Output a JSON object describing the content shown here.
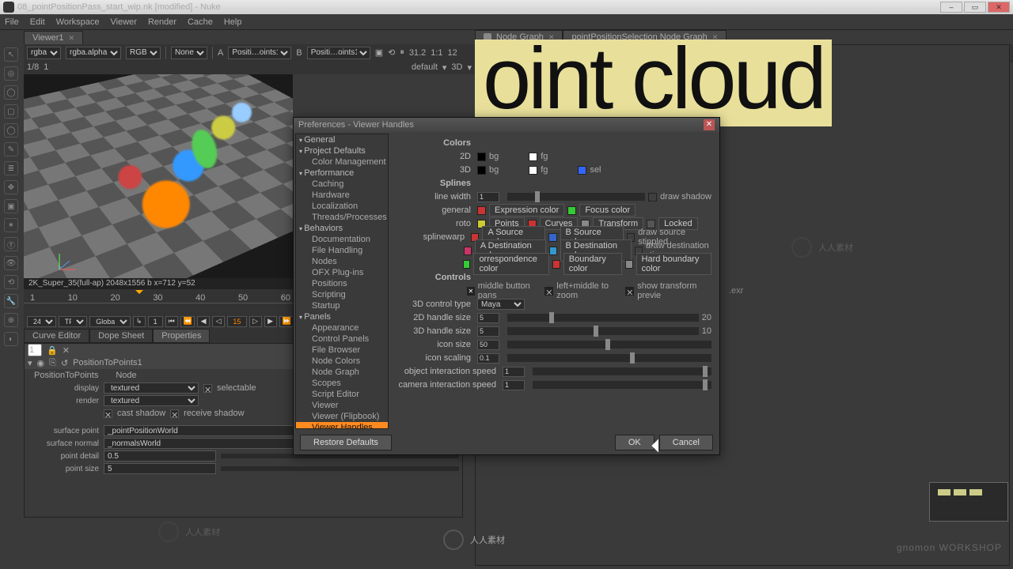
{
  "window": {
    "title": "08_pointPositionPass_start_wip.nk [modified] - Nuke"
  },
  "menu": [
    "File",
    "Edit",
    "Workspace",
    "Viewer",
    "Render",
    "Cache",
    "Help"
  ],
  "viewerTab": "Viewer1",
  "viewerBar": {
    "channels": "rgba",
    "alpha": "rgba.alpha",
    "mode": "RGB",
    "overlay": "None",
    "a": "A",
    "aName": "Positi…oints1",
    "b": "B",
    "bName": "Positi…oints1",
    "zoom": "31.2",
    "ratio": "1:1",
    "fps": "12"
  },
  "viewerBar2": {
    "ip": "1/8",
    "f": "1",
    "fmt": "default",
    "dim": "3D"
  },
  "status": "2K_Super_35(full-ap) 2048x1556  b  x=712 y=52",
  "timeline": {
    "ticks": [
      "1",
      "10",
      "20",
      "30",
      "40",
      "50",
      "60"
    ],
    "fps": "24",
    "mode": "TF",
    "scope": "Global",
    "frame": "15"
  },
  "panelTabs": [
    "Curve Editor",
    "Dope Sheet",
    "Properties"
  ],
  "node": {
    "name": "PositionToPoints1",
    "tabs": [
      "PositionToPoints",
      "Node"
    ],
    "display": "textured",
    "displayOpts": "selectable",
    "render": "textured",
    "castShadow": "cast shadow",
    "recvShadow": "receive shadow",
    "surfacePoint": "_pointPositionWorld",
    "surfaceNormal": "_normalsWorld",
    "pointDetail": "0.5",
    "pointSize": "5",
    "lab": {
      "display": "display",
      "render": "render",
      "sp": "surface point",
      "sn": "surface normal",
      "pd": "point detail",
      "ps": "point size"
    }
  },
  "ngTabs": [
    "Node Graph",
    "pointPositionSelection Node Graph"
  ],
  "overlay": "oint cloud",
  "exr": ".exr",
  "gnomon": "gnomon WORKSHOP",
  "watermark": "人人素材",
  "dialog": {
    "title": "Preferences - Viewer Handles",
    "tree": {
      "general": "General",
      "project": "Project Defaults",
      "colorMgmt": "Color Management",
      "performance": "Performance",
      "caching": "Caching",
      "hardware": "Hardware",
      "localization": "Localization",
      "threads": "Threads/Processes",
      "behaviors": "Behaviors",
      "documentation": "Documentation",
      "fileHandling": "File Handling",
      "nodes": "Nodes",
      "ofx": "OFX Plug-ins",
      "positions": "Positions",
      "scripting": "Scripting",
      "startup": "Startup",
      "panels": "Panels",
      "appearance": "Appearance",
      "controlPanels": "Control Panels",
      "fileBrowser": "File Browser",
      "nodeColors": "Node Colors",
      "nodeGraph": "Node Graph",
      "scopes": "Scopes",
      "scriptEditor": "Script Editor",
      "viewer": "Viewer",
      "flipbook": "Viewer (Flipbook)",
      "handles": "Viewer Handles"
    },
    "sections": {
      "colors": "Colors",
      "splines": "Splines",
      "controls": "Controls"
    },
    "rows": {
      "d2": "2D",
      "d3": "3D",
      "bg": "bg",
      "fg": "fg",
      "sel": "sel",
      "lineWidth": "line width",
      "lineWidthV": "1",
      "drawShadow": "draw shadow",
      "general": "general",
      "exprColor": "Expression color",
      "focusColor": "Focus color",
      "roto": "roto",
      "points": "Points",
      "curves": "Curves",
      "transform": "Transform",
      "locked": "Locked",
      "splinewarp": "splinewarp",
      "aSrc": "A Source color",
      "bSrc": "B Source color",
      "drawSrcStip": "draw source stippled",
      "aDest": "A Destination color",
      "bDest": "B Destination color",
      "drawDestStip": "draw destination stip",
      "corrColor": "orrespondence color",
      "boundColor": "Boundary color",
      "hardBound": "Hard boundary color",
      "midPans": "middle button pans",
      "leftMid": "left+middle to zoom",
      "showTrans": "show transform previe",
      "ctrlType": "3D control type",
      "ctrlTypeV": "Maya",
      "h2d": "2D handle size",
      "h2dV": "5",
      "h2dMax": "20",
      "h3d": "3D handle size",
      "h3dV": "5",
      "h3dMax": "10",
      "iconSize": "icon size",
      "iconSizeV": "50",
      "iconScaling": "icon scaling",
      "iconScalingV": "0.1",
      "objSpeed": "object interaction speed",
      "objSpeedV": "1",
      "camSpeed": "camera interaction speed",
      "camSpeedV": "1"
    },
    "buttons": {
      "restore": "Restore Defaults",
      "ok": "OK",
      "cancel": "Cancel"
    }
  }
}
